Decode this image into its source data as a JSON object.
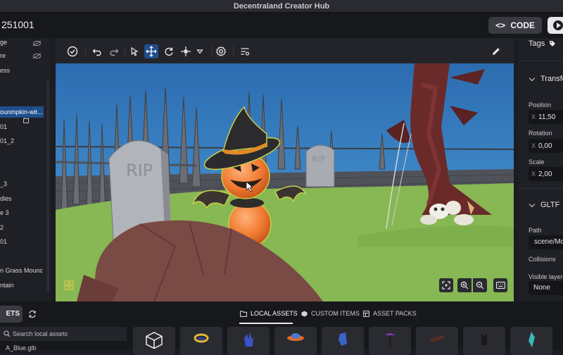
{
  "window": {
    "title": "Decentraland Creator Hub"
  },
  "header": {
    "project_name": "251001",
    "code_label": "CODE"
  },
  "left_panel": {
    "items": [
      {
        "label": "ge"
      },
      {
        "label": "re"
      },
      {
        "label": "ess"
      },
      {
        "label": "ounmpkin-wit..."
      },
      {
        "label": "01"
      },
      {
        "label": "01_2"
      },
      {
        "label": "_3"
      },
      {
        "label": "dles"
      },
      {
        "label": "e 3"
      },
      {
        "label": "2"
      },
      {
        "label": "01"
      },
      {
        "label": "n Grass Mounc"
      },
      {
        "label": "ntain"
      }
    ]
  },
  "right_panel": {
    "tags_label": "Tags",
    "transform_label": "Transform",
    "position_label": "Position",
    "position_axis": "X",
    "position_value": "11,50",
    "rotation_label": "Rotation",
    "rotation_axis": "X",
    "rotation_value": "0,00",
    "scale_label": "Scale",
    "scale_axis": "X",
    "scale_value": "2,00",
    "gltf_label": "GLTF",
    "path_label": "Path",
    "path_value": "scene/Mo",
    "collisions_label": "Collisions",
    "visible_layer_label": "Visible layer",
    "visible_layer_value": "None"
  },
  "scene_text": {
    "rip_front": "RIP",
    "rip_back": "RIP"
  },
  "bottom": {
    "assets_label": "ETS",
    "tabs": [
      {
        "label": "LOCAL ASSETS",
        "icon": "folder-icon"
      },
      {
        "label": "CUSTOM ITEMS",
        "icon": "cube-icon"
      },
      {
        "label": "ASSET PACKS",
        "icon": "pack-icon"
      }
    ],
    "search_placeholder": "Search local assets",
    "file_label": "A_Blue.glb"
  },
  "colors": {
    "accent": "#1f4e8c",
    "sky": "#2f6fb3",
    "grass": "#88bb55",
    "pumpkin": "#f07a30"
  }
}
